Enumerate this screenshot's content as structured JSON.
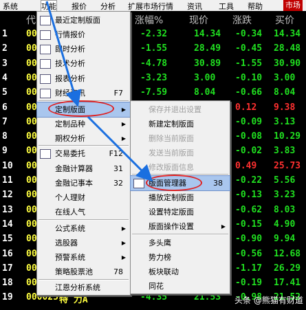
{
  "menubar": {
    "items": [
      "系统",
      "功能",
      "报价",
      "分析",
      "扩展市场行情",
      "资讯",
      "工具",
      "帮助",
      "市场"
    ]
  },
  "header": {
    "columns": [
      "代",
      "涨幅%",
      "现价",
      "涨跌",
      "买价"
    ]
  },
  "rows": [
    {
      "no": "1",
      "code": "00",
      "pct": "-2.32",
      "price": "14.34",
      "chg": "-0.34",
      "bid": "14.34",
      "c1": "g",
      "c2": "g",
      "c3": "g",
      "c4": "g"
    },
    {
      "no": "2",
      "code": "00",
      "pct": "-1.55",
      "price": "28.49",
      "chg": "-0.45",
      "bid": "28.48",
      "c1": "g",
      "c2": "g",
      "c3": "g",
      "c4": "g"
    },
    {
      "no": "3",
      "code": "00",
      "pct": "-4.78",
      "price": "30.89",
      "chg": "-1.55",
      "bid": "30.90",
      "c1": "g",
      "c2": "g",
      "c3": "g",
      "c4": "g"
    },
    {
      "no": "4",
      "code": "00",
      "pct": "-3.23",
      "price": "3.00",
      "chg": "-0.10",
      "bid": "3.00",
      "c1": "g",
      "c2": "g",
      "c3": "g",
      "c4": "g"
    },
    {
      "no": "5",
      "code": "00",
      "pct": "-7.59",
      "price": "8.04",
      "chg": "-0.66",
      "bid": "8.04",
      "c1": "g",
      "c2": "g",
      "c3": "g",
      "c4": "g"
    },
    {
      "no": "6",
      "code": "00",
      "pct": "",
      "price": "",
      "chg": "0.12",
      "bid": "9.38",
      "c1": "g",
      "c2": "g",
      "c3": "r",
      "c4": "r"
    },
    {
      "no": "7",
      "code": "00",
      "pct": "",
      "price": "",
      "chg": "-0.09",
      "bid": "3.13",
      "c1": "g",
      "c2": "g",
      "c3": "g",
      "c4": "g"
    },
    {
      "no": "8",
      "code": "00",
      "pct": "",
      "price": "",
      "chg": "-0.08",
      "bid": "10.29",
      "c1": "g",
      "c2": "g",
      "c3": "g",
      "c4": "g"
    },
    {
      "no": "9",
      "code": "00",
      "pct": "",
      "price": "",
      "chg": "-0.02",
      "bid": "3.83",
      "c1": "g",
      "c2": "g",
      "c3": "g",
      "c4": "g"
    },
    {
      "no": "10",
      "code": "00",
      "pct": "",
      "price": "",
      "chg": "0.49",
      "bid": "25.73",
      "c1": "g",
      "c2": "g",
      "c3": "r",
      "c4": "r"
    },
    {
      "no": "11",
      "code": "00",
      "pct": "",
      "price": "",
      "chg": "-0.22",
      "bid": "5.56",
      "c1": "g",
      "c2": "g",
      "c3": "g",
      "c4": "g"
    },
    {
      "no": "12",
      "code": "00",
      "pct": "",
      "price": "",
      "chg": "-0.13",
      "bid": "3.23",
      "c1": "g",
      "c2": "g",
      "c3": "g",
      "c4": "g"
    },
    {
      "no": "13",
      "code": "00",
      "pct": "",
      "price": "",
      "chg": "-0.62",
      "bid": "8.03",
      "c1": "g",
      "c2": "g",
      "c3": "g",
      "c4": "g"
    },
    {
      "no": "14",
      "code": "00",
      "pct": "",
      "price": "",
      "chg": "-0.15",
      "bid": "4.90",
      "c1": "g",
      "c2": "g",
      "c3": "g",
      "c4": "g"
    },
    {
      "no": "15",
      "code": "00",
      "pct": "",
      "price": "",
      "chg": "-0.90",
      "bid": "9.94",
      "c1": "g",
      "c2": "g",
      "c3": "g",
      "c4": "g"
    },
    {
      "no": "16",
      "code": "00",
      "pct": "",
      "price": "",
      "chg": "-0.56",
      "bid": "12.68",
      "c1": "g",
      "c2": "g",
      "c3": "g",
      "c4": "g"
    },
    {
      "no": "17",
      "code": "00",
      "pct": "",
      "price": "",
      "chg": "-1.17",
      "bid": "26.29",
      "c1": "g",
      "c2": "g",
      "c3": "g",
      "c4": "g"
    },
    {
      "no": "18",
      "code": "00",
      "pct": "",
      "price": "",
      "chg": "-0.19",
      "bid": "17.41",
      "c1": "g",
      "c2": "g",
      "c3": "g",
      "c4": "g"
    },
    {
      "no": "19",
      "code": "000025",
      "name": "特 力A",
      "pct": "-4.35",
      "price": "21.53",
      "chg": "-0.98",
      "bid": "21.52",
      "c1": "g",
      "c2": "g",
      "c3": "g",
      "c4": "g"
    }
  ],
  "menu1": {
    "items": [
      {
        "label": "最近定制版面",
        "shortcut": "",
        "arrow": false,
        "icon": "recent-layout-icon"
      },
      {
        "label": "行情报价",
        "shortcut": "",
        "arrow": false,
        "icon": "quote-table-icon"
      },
      {
        "label": "即时分析",
        "shortcut": "",
        "arrow": false,
        "icon": "realtime-chart-icon"
      },
      {
        "label": "技术分析",
        "shortcut": "",
        "arrow": false,
        "icon": "candlestick-icon"
      },
      {
        "label": "报表分析",
        "shortcut": "",
        "arrow": false,
        "icon": "report-icon"
      },
      {
        "label": "财经资讯",
        "shortcut": "F7",
        "arrow": false,
        "icon": "news-icon"
      },
      {
        "label": "定制版面",
        "shortcut": "",
        "arrow": true,
        "icon": ""
      },
      {
        "label": "定制品种",
        "shortcut": "",
        "arrow": true,
        "icon": ""
      },
      {
        "label": "期权分析",
        "shortcut": "",
        "arrow": true,
        "icon": ""
      },
      {
        "label": "交易委托",
        "shortcut": "F12",
        "arrow": false,
        "icon": "f12-icon"
      },
      {
        "label": "金融计算器",
        "shortcut": "31",
        "arrow": false,
        "icon": ""
      },
      {
        "label": "金融记事本",
        "shortcut": "32",
        "arrow": false,
        "icon": ""
      },
      {
        "label": "个人理财",
        "shortcut": "",
        "arrow": false,
        "icon": ""
      },
      {
        "label": "在线人气",
        "shortcut": "",
        "arrow": false,
        "icon": ""
      },
      {
        "label": "公式系统",
        "shortcut": "",
        "arrow": true,
        "icon": ""
      },
      {
        "label": "选股器",
        "shortcut": "",
        "arrow": true,
        "icon": ""
      },
      {
        "label": "预警系统",
        "shortcut": "",
        "arrow": true,
        "icon": ""
      },
      {
        "label": "策略股票池",
        "shortcut": "78",
        "arrow": false,
        "icon": ""
      },
      {
        "label": "江恩分析系统",
        "shortcut": "",
        "arrow": false,
        "icon": ""
      }
    ]
  },
  "menu2": {
    "items": [
      {
        "label": "保存并退出设置",
        "shortcut": "",
        "disabled": true,
        "arrow": false
      },
      {
        "label": "新建定制版面",
        "shortcut": "",
        "disabled": false,
        "arrow": false
      },
      {
        "label": "删除当前版面",
        "shortcut": "",
        "disabled": true,
        "arrow": false
      },
      {
        "label": "发送当前版面",
        "shortcut": "",
        "disabled": true,
        "arrow": false
      },
      {
        "label": "修改版面信息",
        "shortcut": "",
        "disabled": true,
        "arrow": false
      },
      {
        "label": "版面管理器",
        "shortcut": "38",
        "disabled": false,
        "arrow": false
      },
      {
        "label": "播放定制版面",
        "shortcut": "",
        "disabled": false,
        "arrow": false
      },
      {
        "label": "设置特定版面",
        "shortcut": "",
        "disabled": false,
        "arrow": false
      },
      {
        "label": "版面操作设置",
        "shortcut": "",
        "disabled": false,
        "arrow": true
      },
      {
        "label": "多头鹰",
        "shortcut": "",
        "disabled": false,
        "arrow": false
      },
      {
        "label": "势力榜",
        "shortcut": "",
        "disabled": false,
        "arrow": false
      },
      {
        "label": "板块联动",
        "shortcut": "",
        "disabled": false,
        "arrow": false
      },
      {
        "label": "同花",
        "shortcut": "",
        "disabled": false,
        "arrow": false
      }
    ]
  },
  "watermark": "头条 @熊猫有财道",
  "colors": {
    "accent_red": "#e02020",
    "arrow_blue": "#1a6fe0",
    "highlight": "#a9c6ee"
  }
}
